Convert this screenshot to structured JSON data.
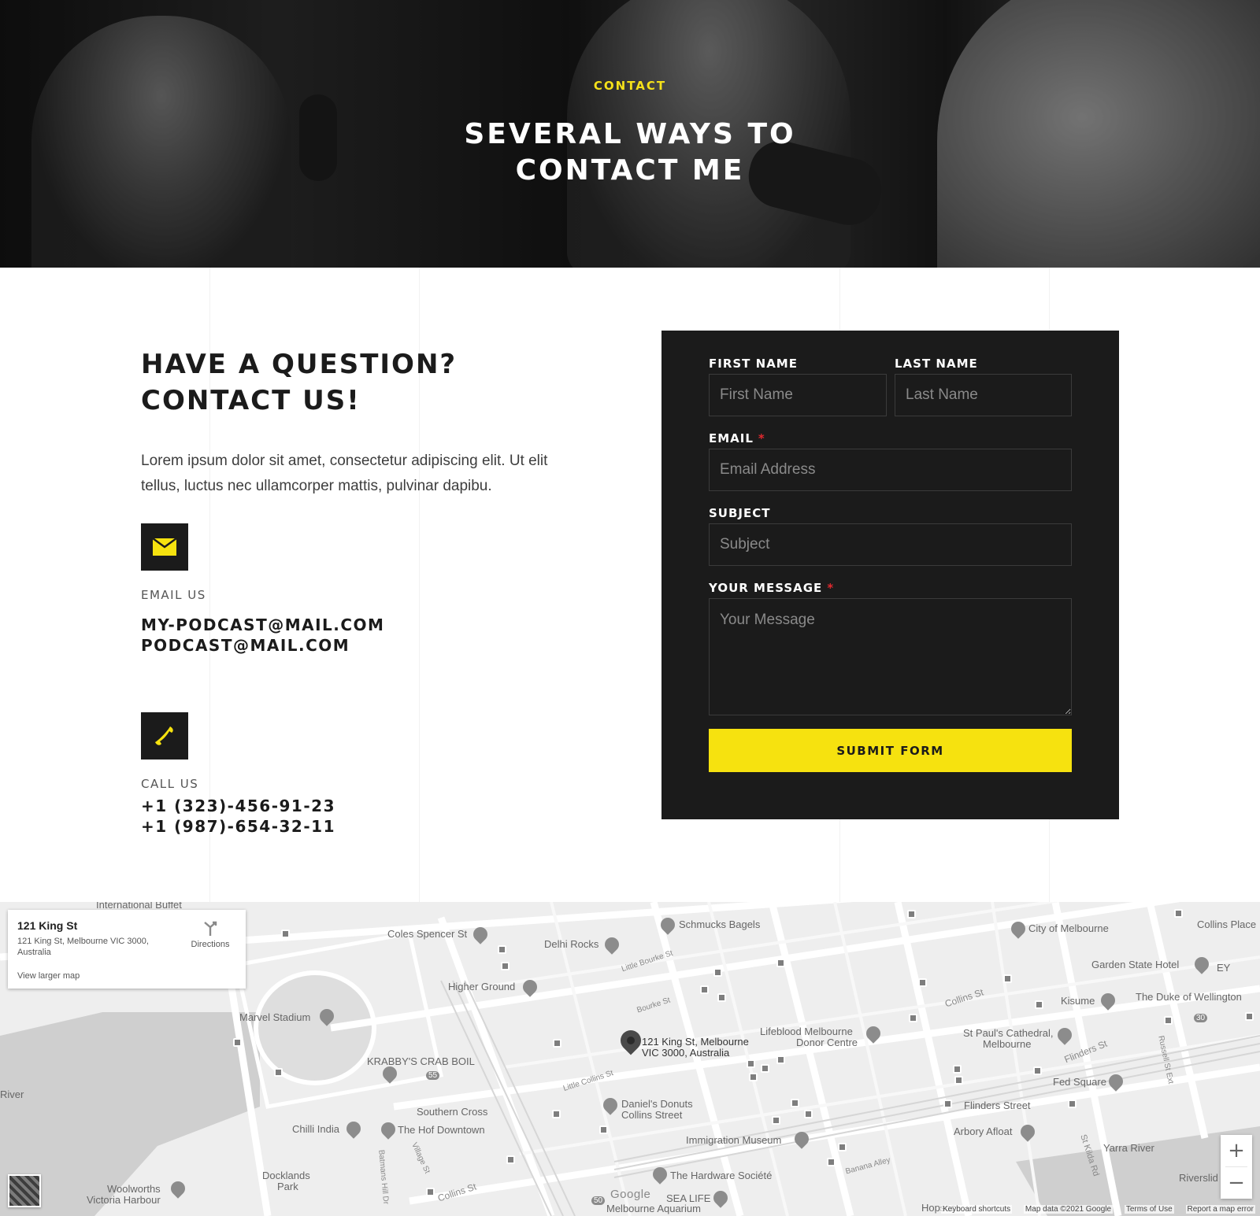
{
  "hero": {
    "eyebrow": "CONTACT",
    "title": "SEVERAL WAYS TO CONTACT ME"
  },
  "intro": {
    "title_line1": "HAVE A QUESTION?",
    "title_line2": "CONTACT US!",
    "text": "Lorem ipsum dolor sit amet, consectetur adipiscing elit. Ut elit tellus, luctus nec ullamcorper mattis, pulvinar dapibu."
  },
  "email_block": {
    "icon": "envelope-icon",
    "label": "EMAIL US",
    "values": [
      "MY-PODCAST@MAIL.COM",
      "PODCAST@MAIL.COM"
    ]
  },
  "phone_block": {
    "icon": "phone-icon",
    "label": "CALL US",
    "values": [
      "+1 (323)-456-91-23",
      "+1 (987)-654-32-11"
    ]
  },
  "form": {
    "first_name": {
      "label": "FIRST NAME",
      "placeholder": "First Name"
    },
    "last_name": {
      "label": "LAST NAME",
      "placeholder": "Last Name"
    },
    "email": {
      "label": "EMAIL",
      "required_mark": "*",
      "placeholder": "Email Address"
    },
    "subject": {
      "label": "SUBJECT",
      "placeholder": "Subject"
    },
    "message": {
      "label": "YOUR MESSAGE",
      "required_mark": "*",
      "placeholder": "Your Message"
    },
    "submit_label": "SUBMIT FORM"
  },
  "map": {
    "card": {
      "title": "121 King St",
      "address": "121 King St, Melbourne VIC 3000, Australia",
      "directions_label": "Directions",
      "larger_map_link": "View larger map"
    },
    "pin_label_line1": "121 King St, Melbourne",
    "pin_label_line2": "VIC 3000, Australia",
    "places": [
      "International Buffet",
      "Coles Spencer St",
      "Schmucks Bagels",
      "Delhi Rocks",
      "City of Melbourne",
      "Collins Place",
      "Garden State Hotel",
      "EY",
      "Higher Ground",
      "Marvel Stadium",
      "Kisume",
      "The Duke of Wellington",
      "Lifeblood Melbourne",
      "Donor Centre",
      "St Paul's Cathedral,",
      "Melbourne",
      "KRABBY'S CRAB BOIL",
      "Fed Square",
      "Southern Cross",
      "Daniel's Donuts",
      "Collins Street",
      "Flinders Street",
      "Chilli India",
      "The Hof Downtown",
      "Arbory Afloat",
      "Immigration Museum",
      "Yarra River",
      "Docklands",
      "Park",
      "The Hardware Société",
      "Woolworths",
      "Victoria Harbour",
      "SEA LIFE",
      "Melbourne Aquarium",
      "Riverslid",
      "River",
      "Hopscc"
    ],
    "streets": [
      "Little Bourke St",
      "Bourke St",
      "Collins St",
      "Flinders St",
      "Little Collins St",
      "Russell St Ext",
      "St Kilda Rd",
      "Banana Alley",
      "Batmans Hill Dr",
      "Village St",
      "Collins St"
    ],
    "badges": [
      "55",
      "30",
      "50"
    ],
    "zoom_in": "+",
    "zoom_out": "−",
    "logo": "Google",
    "footer": [
      "Keyboard shortcuts",
      "Map data ©2021 Google",
      "Terms of Use",
      "Report a map error"
    ]
  }
}
